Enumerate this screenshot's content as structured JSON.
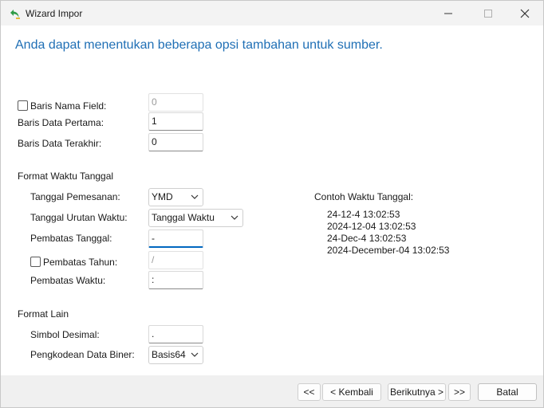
{
  "window": {
    "title": "Wizard Impor"
  },
  "heading": "Anda dapat menentukan beberapa opsi tambahan untuk sumber.",
  "rows": {
    "field_name_row": {
      "label": "Baris Nama Field:",
      "checked": false,
      "value": "0"
    },
    "first_data_row": {
      "label": "Baris Data Pertama:",
      "value": "1"
    },
    "last_data_row": {
      "label": "Baris Data Terakhir:",
      "value": "0"
    }
  },
  "datetime_format": {
    "section_label": "Format Waktu Tanggal",
    "date_order": {
      "label": "Tanggal Pemesanan:",
      "value": "YMD"
    },
    "date_time_order": {
      "label": "Tanggal Urutan Waktu:",
      "value": "Tanggal Waktu"
    },
    "date_delimiter": {
      "label": "Pembatas Tanggal:",
      "value": "-"
    },
    "year_delimiter": {
      "label": "Pembatas Tahun:",
      "checked": false,
      "value": "/"
    },
    "time_delimiter": {
      "label": "Pembatas Waktu:",
      "value": ":"
    },
    "example_label": "Contoh Waktu Tanggal:",
    "examples": [
      "24-12-4 13:02:53",
      "2024-12-04 13:02:53",
      "24-Dec-4 13:02:53",
      "2024-December-04 13:02:53"
    ]
  },
  "other_format": {
    "section_label": "Format Lain",
    "decimal_symbol": {
      "label": "Simbol Desimal:",
      "value": "."
    },
    "binary_encoding": {
      "label": "Pengkodean Data Biner:",
      "value": "Basis64"
    }
  },
  "footer": {
    "first_label": "<<",
    "back_label": "< Kembali",
    "next_label": "Berikutnya >",
    "last_label": ">>",
    "cancel_label": "Batal"
  },
  "colors": {
    "heading": "#1f6fb5",
    "accent": "#0067c0",
    "icon_green": "#2e9b47"
  },
  "icons": {
    "app": "green-back-arrow-icon",
    "minimize": "minimize-icon",
    "maximize": "maximize-icon",
    "close": "close-icon",
    "dropdown": "chevron-down-icon"
  }
}
